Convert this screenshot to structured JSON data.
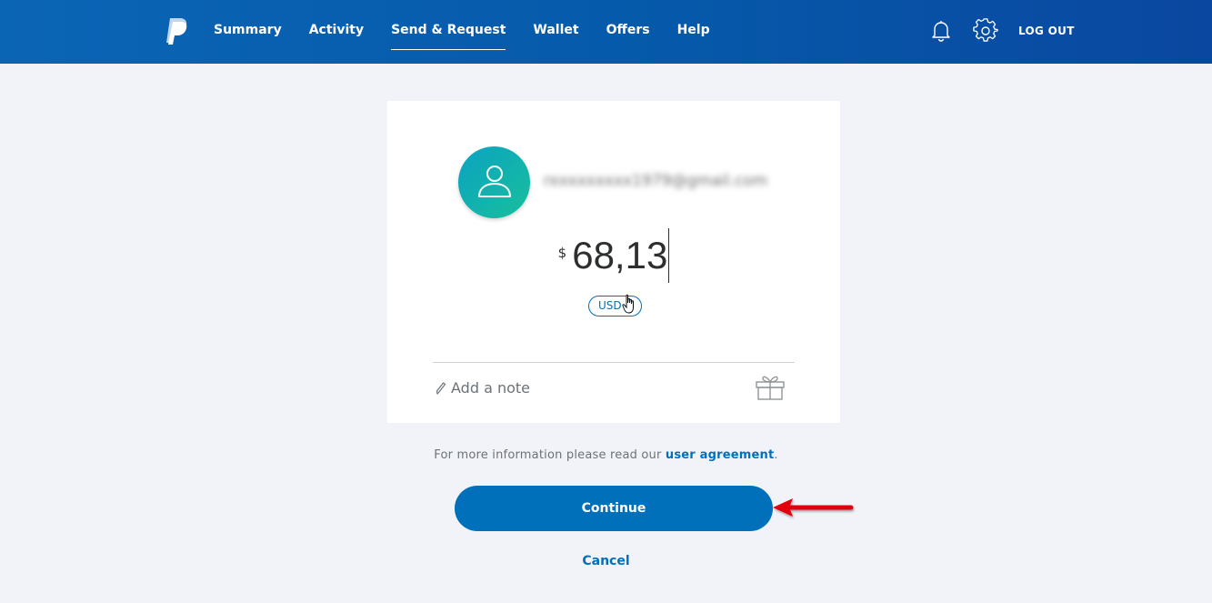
{
  "header": {
    "nav": [
      {
        "label": "Summary",
        "active": false
      },
      {
        "label": "Activity",
        "active": false
      },
      {
        "label": "Send & Request",
        "active": true
      },
      {
        "label": "Wallet",
        "active": false
      },
      {
        "label": "Offers",
        "active": false
      },
      {
        "label": "Help",
        "active": false
      }
    ],
    "logout_label": "LOG OUT",
    "icons": [
      "paypal-logo",
      "bell-icon",
      "gear-icon"
    ]
  },
  "payment": {
    "recipient": "rxxxxxxxxx1979@gmail.com",
    "currency_symbol": "$",
    "amount": "68,13",
    "currency_code": "USD",
    "note_placeholder": "Add a note"
  },
  "footer": {
    "info_prefix": "For more information please read our ",
    "info_link": "user agreement",
    "info_suffix": ".",
    "continue_label": "Continue",
    "cancel_label": "Cancel"
  },
  "colors": {
    "header": "#0b65b5",
    "accent": "#0070ba",
    "avatar_from": "#0aa3c2",
    "avatar_to": "#19bf9c",
    "annotation_arrow": "#e3000f"
  }
}
